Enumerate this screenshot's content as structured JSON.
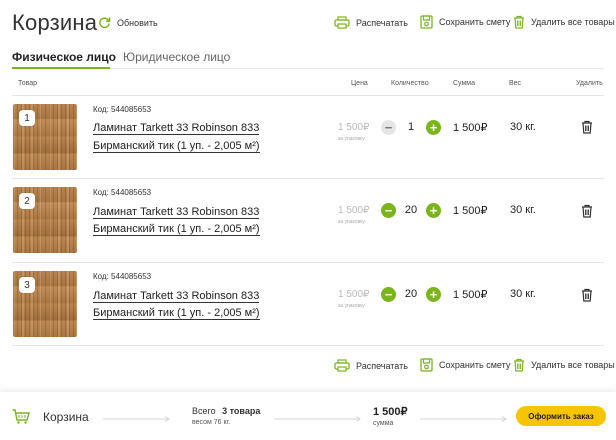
{
  "header": {
    "title": "Корзина",
    "refresh_label": "Обновить",
    "print_label": "Распечатать",
    "save_label": "Сохранить смету",
    "delete_all_label": "Удалить все товары"
  },
  "tabs": [
    {
      "label": "Физическое лицо",
      "active": true
    },
    {
      "label": "Юридическое лицо",
      "active": false
    }
  ],
  "table": {
    "columns": {
      "product": "Товар",
      "price": "Цена",
      "quantity": "Количество",
      "sum": "Сумма",
      "weight": "Вес",
      "delete": "Удалить"
    },
    "rows": [
      {
        "num": "1",
        "code": "Код: 544085653",
        "name_line1": "Ламинат Tarkett 33 Robinson 833",
        "name_line2": "Бирманский тик (1 уп. - 2,005 м²)",
        "price": "1 500₽",
        "per_pack": "за упаковку",
        "qty": "1",
        "sum": "1 500₽",
        "weight": "30 кг."
      },
      {
        "num": "2",
        "code": "Код: 544085653",
        "name_line1": "Ламинат Tarkett 33 Robinson 833",
        "name_line2": "Бирманский тик (1 уп. - 2,005 м²)",
        "price": "1 500₽",
        "per_pack": "за упаковку",
        "qty": "20",
        "sum": "1 500₽",
        "weight": "30 кг."
      },
      {
        "num": "3",
        "code": "Код: 544085653",
        "name_line1": "Ламинат Tarkett 33 Robinson 833",
        "name_line2": "Бирманский тик (1 уп. - 2,005 м²)",
        "price": "1 500₽",
        "per_pack": "за упаковку",
        "qty": "20",
        "sum": "1 500₽",
        "weight": "30 кг."
      }
    ]
  },
  "bottom_tools": {
    "print_label": "Распечатать",
    "save_label": "Сохранить смету",
    "delete_all_label": "Удалить все товары"
  },
  "footer": {
    "cart_label": "Корзина",
    "total_prefix": "Всего",
    "total_items": "3 товара",
    "weight_text": "весом 76 кг.",
    "total_sum": "1 500₽",
    "sum_label": "сумма",
    "order_button": "Оформить заказ"
  },
  "colors": {
    "accent": "#7ab51d",
    "order_button": "#f7c500"
  },
  "icons": [
    "refresh-icon",
    "printer-icon",
    "save-icon",
    "trash-icon",
    "cart-icon",
    "arrow-right-icon",
    "minus-icon",
    "plus-icon"
  ]
}
